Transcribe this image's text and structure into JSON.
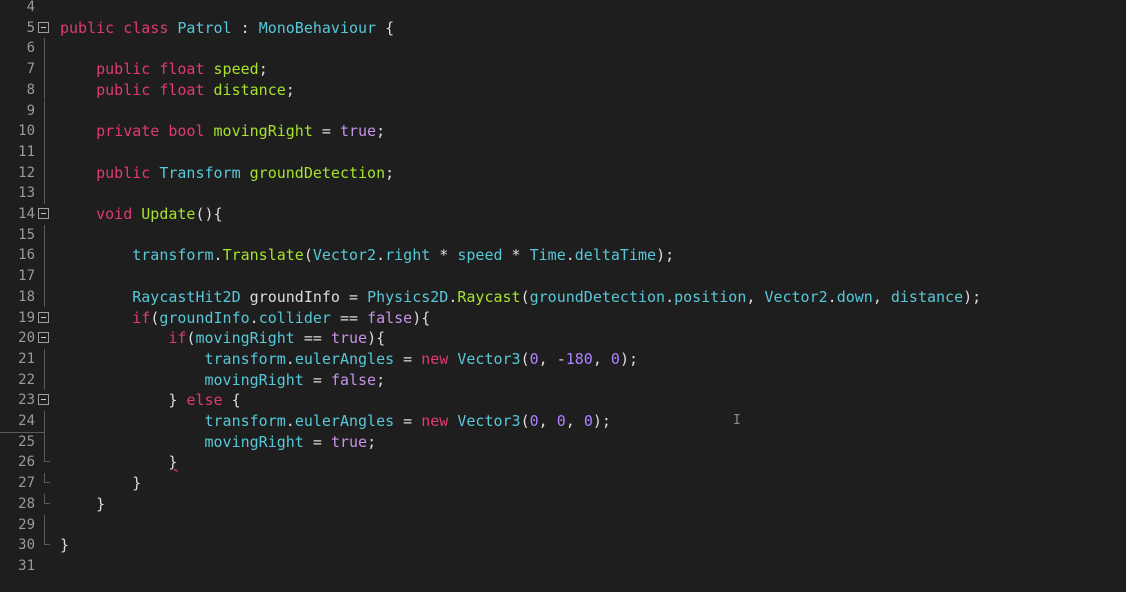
{
  "editor": {
    "lines": [
      {
        "n": "4",
        "fold": "none",
        "tokens": []
      },
      {
        "n": "5",
        "fold": "open",
        "tokens": [
          [
            "kw",
            "public class "
          ],
          [
            "type",
            "Patrol"
          ],
          [
            "plain",
            " : "
          ],
          [
            "type",
            "MonoBehaviour"
          ],
          [
            "plain",
            " {"
          ]
        ]
      },
      {
        "n": "6",
        "fold": "line",
        "tokens": []
      },
      {
        "n": "7",
        "fold": "line",
        "tokens": [
          [
            "plain",
            "    "
          ],
          [
            "kw",
            "public float "
          ],
          [
            "name",
            "speed"
          ],
          [
            "plain",
            ";"
          ]
        ]
      },
      {
        "n": "8",
        "fold": "line",
        "tokens": [
          [
            "plain",
            "    "
          ],
          [
            "kw",
            "public float "
          ],
          [
            "name",
            "distance"
          ],
          [
            "plain",
            ";"
          ]
        ]
      },
      {
        "n": "9",
        "fold": "line",
        "tokens": []
      },
      {
        "n": "10",
        "fold": "line",
        "tokens": [
          [
            "plain",
            "    "
          ],
          [
            "kw",
            "private bool "
          ],
          [
            "name",
            "movingRight"
          ],
          [
            "plain",
            " = "
          ],
          [
            "kw2",
            "true"
          ],
          [
            "plain",
            ";"
          ]
        ]
      },
      {
        "n": "11",
        "fold": "line",
        "tokens": []
      },
      {
        "n": "12",
        "fold": "line",
        "tokens": [
          [
            "plain",
            "    "
          ],
          [
            "kw",
            "public "
          ],
          [
            "type",
            "Transform "
          ],
          [
            "name",
            "groundDetection"
          ],
          [
            "plain",
            ";"
          ]
        ]
      },
      {
        "n": "13",
        "fold": "line",
        "tokens": []
      },
      {
        "n": "14",
        "fold": "open",
        "tokens": [
          [
            "plain",
            "    "
          ],
          [
            "kw",
            "void "
          ],
          [
            "name",
            "Update"
          ],
          [
            "plain",
            "(){"
          ]
        ]
      },
      {
        "n": "15",
        "fold": "line",
        "tokens": []
      },
      {
        "n": "16",
        "fold": "line",
        "tokens": [
          [
            "plain",
            "        "
          ],
          [
            "type",
            "transform"
          ],
          [
            "plain",
            "."
          ],
          [
            "name",
            "Translate"
          ],
          [
            "plain",
            "("
          ],
          [
            "type",
            "Vector2"
          ],
          [
            "plain",
            "."
          ],
          [
            "type",
            "right"
          ],
          [
            "plain",
            " * "
          ],
          [
            "type",
            "speed"
          ],
          [
            "plain",
            " * "
          ],
          [
            "type",
            "Time"
          ],
          [
            "plain",
            "."
          ],
          [
            "type",
            "deltaTime"
          ],
          [
            "plain",
            ");"
          ]
        ]
      },
      {
        "n": "17",
        "fold": "line",
        "tokens": []
      },
      {
        "n": "18",
        "fold": "line",
        "tokens": [
          [
            "plain",
            "        "
          ],
          [
            "type",
            "RaycastHit2D "
          ],
          [
            "plain",
            "groundInfo = "
          ],
          [
            "type",
            "Physics2D"
          ],
          [
            "plain",
            "."
          ],
          [
            "name",
            "Raycast"
          ],
          [
            "plain",
            "("
          ],
          [
            "type",
            "groundDetection"
          ],
          [
            "plain",
            "."
          ],
          [
            "type",
            "position"
          ],
          [
            "plain",
            ", "
          ],
          [
            "type",
            "Vector2"
          ],
          [
            "plain",
            "."
          ],
          [
            "type",
            "down"
          ],
          [
            "plain",
            ", "
          ],
          [
            "type",
            "distance"
          ],
          [
            "plain",
            ");"
          ]
        ]
      },
      {
        "n": "19",
        "fold": "open",
        "tokens": [
          [
            "plain",
            "        "
          ],
          [
            "kw",
            "if"
          ],
          [
            "plain",
            "("
          ],
          [
            "type",
            "groundInfo"
          ],
          [
            "plain",
            "."
          ],
          [
            "type",
            "collider"
          ],
          [
            "plain",
            " == "
          ],
          [
            "kw2",
            "false"
          ],
          [
            "plain",
            "){"
          ]
        ]
      },
      {
        "n": "20",
        "fold": "open",
        "tokens": [
          [
            "plain",
            "            "
          ],
          [
            "kw",
            "if"
          ],
          [
            "plain",
            "("
          ],
          [
            "type",
            "movingRight"
          ],
          [
            "plain",
            " == "
          ],
          [
            "kw2",
            "true"
          ],
          [
            "plain",
            "){"
          ]
        ]
      },
      {
        "n": "21",
        "fold": "line",
        "tokens": [
          [
            "plain",
            "                "
          ],
          [
            "type",
            "transform"
          ],
          [
            "plain",
            "."
          ],
          [
            "type",
            "eulerAngles"
          ],
          [
            "plain",
            " = "
          ],
          [
            "kw",
            "new "
          ],
          [
            "type",
            "Vector3"
          ],
          [
            "plain",
            "("
          ],
          [
            "num",
            "0"
          ],
          [
            "plain",
            ", -"
          ],
          [
            "num",
            "180"
          ],
          [
            "plain",
            ", "
          ],
          [
            "num",
            "0"
          ],
          [
            "plain",
            ");"
          ]
        ]
      },
      {
        "n": "22",
        "fold": "line",
        "tokens": [
          [
            "plain",
            "                "
          ],
          [
            "type",
            "movingRight"
          ],
          [
            "plain",
            " = "
          ],
          [
            "kw2",
            "false"
          ],
          [
            "plain",
            ";"
          ]
        ]
      },
      {
        "n": "23",
        "fold": "open",
        "tokens": [
          [
            "plain",
            "            } "
          ],
          [
            "kw",
            "else"
          ],
          [
            "plain",
            " {"
          ]
        ]
      },
      {
        "n": "24",
        "fold": "line",
        "tokens": [
          [
            "plain",
            "                "
          ],
          [
            "type",
            "transform"
          ],
          [
            "plain",
            "."
          ],
          [
            "type",
            "eulerAngles"
          ],
          [
            "plain",
            " = "
          ],
          [
            "kw",
            "new "
          ],
          [
            "type",
            "Vector3"
          ],
          [
            "plain",
            "("
          ],
          [
            "num",
            "0"
          ],
          [
            "plain",
            ", "
          ],
          [
            "num",
            "0"
          ],
          [
            "plain",
            ", "
          ],
          [
            "num",
            "0"
          ],
          [
            "plain",
            ");"
          ]
        ]
      },
      {
        "n": "25",
        "fold": "line",
        "tokens": [
          [
            "plain",
            "                "
          ],
          [
            "type",
            "movingRight"
          ],
          [
            "plain",
            " = "
          ],
          [
            "kw2",
            "true"
          ],
          [
            "plain",
            ";"
          ]
        ]
      },
      {
        "n": "26",
        "fold": "end",
        "tokens": [
          [
            "plain",
            "            "
          ],
          [
            "err",
            "}"
          ]
        ]
      },
      {
        "n": "27",
        "fold": "end",
        "tokens": [
          [
            "plain",
            "        }"
          ]
        ]
      },
      {
        "n": "28",
        "fold": "end",
        "tokens": [
          [
            "plain",
            "    }"
          ]
        ]
      },
      {
        "n": "29",
        "fold": "line",
        "tokens": []
      },
      {
        "n": "30",
        "fold": "end",
        "tokens": [
          [
            "plain",
            "}"
          ]
        ]
      },
      {
        "n": "31",
        "fold": "none",
        "tokens": []
      }
    ],
    "icons": {
      "fold": "collapse-box-icon",
      "cursor": "text-cursor-icon"
    },
    "colors": {
      "background": "#1e1e1e",
      "keyword": "#e03a6e",
      "literal": "#c792ea",
      "type": "#56c8d8",
      "identifier": "#a6e22e",
      "number": "#ae81ff"
    }
  }
}
